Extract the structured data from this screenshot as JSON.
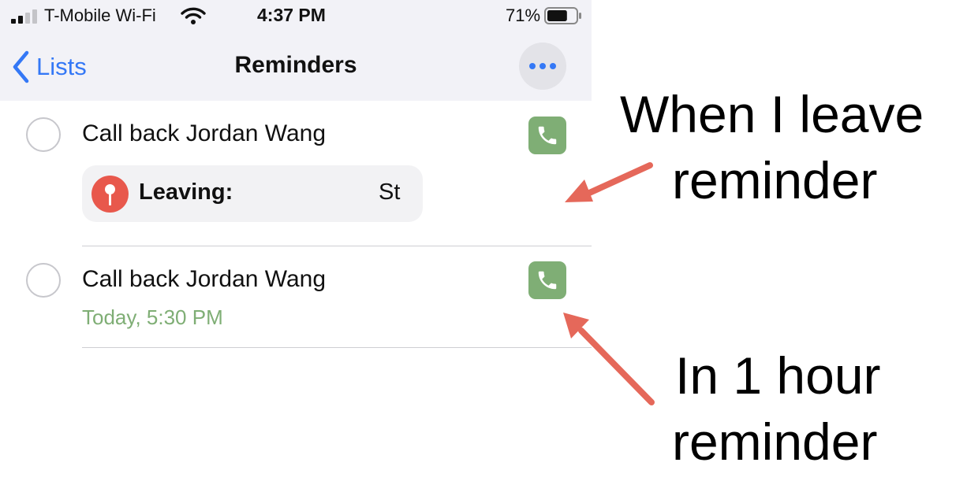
{
  "status_bar": {
    "carrier": "T-Mobile Wi-Fi",
    "time": "4:37 PM",
    "battery_percent": "71%",
    "battery_level": 0.71,
    "signal_bars_filled": 2,
    "signal_bars_total": 4
  },
  "nav": {
    "back_label": "Lists",
    "title": "Reminders",
    "more_icon": "ellipsis-icon"
  },
  "reminders": [
    {
      "title": "Call back Jordan Wang",
      "location_label": "Leaving:",
      "location_value": "St",
      "action_icon": "phone-icon"
    },
    {
      "title": "Call back Jordan Wang",
      "due": "Today, 5:30 PM",
      "action_icon": "phone-icon"
    }
  ],
  "annotations": {
    "top_line1": "When I leave",
    "top_line2": "reminder",
    "bottom_line1": "In 1 hour",
    "bottom_line2": "reminder",
    "arrow_color": "#e5685a"
  },
  "colors": {
    "accent_blue": "#3478f6",
    "due_green": "#7fae75",
    "pin_red": "#e8584c",
    "header_gray": "#f2f2f7"
  }
}
